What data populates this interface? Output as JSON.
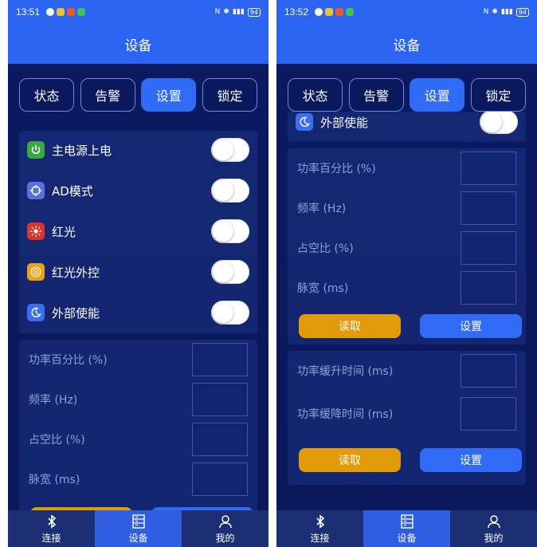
{
  "left": {
    "status": {
      "time": "13:51",
      "battery": "94"
    },
    "title": "设备",
    "tabs": [
      "状态",
      "告警",
      "设置",
      "锁定"
    ],
    "toggles": [
      "主电源上电",
      "AD模式",
      "红光",
      "红光外控",
      "外部使能"
    ],
    "params": [
      "功率百分比 (%)",
      "频率 (Hz)",
      "占空比 (%)",
      "脉宽 (ms)"
    ],
    "nav": [
      "连接",
      "设备",
      "我的"
    ]
  },
  "right": {
    "status": {
      "time": "13:52",
      "battery": "94"
    },
    "title": "设备",
    "tabs": [
      "状态",
      "告警",
      "设置",
      "锁定"
    ],
    "toggle_partial": "外部使能",
    "params": [
      "功率百分比 (%)",
      "频率 (Hz)",
      "占空比 (%)",
      "脉宽 (ms)"
    ],
    "buttons1": {
      "read": "读取",
      "set": "设置"
    },
    "params2": [
      "功率缓升时间 (ms)",
      "功率缓降时间 (ms)"
    ],
    "buttons2": {
      "read": "读取",
      "set": "设置"
    },
    "nav": [
      "连接",
      "设备",
      "我的"
    ]
  },
  "colors": {
    "accent": "#2f6bf5",
    "read_button": "#e29b08",
    "background": "#0b1a5e"
  }
}
